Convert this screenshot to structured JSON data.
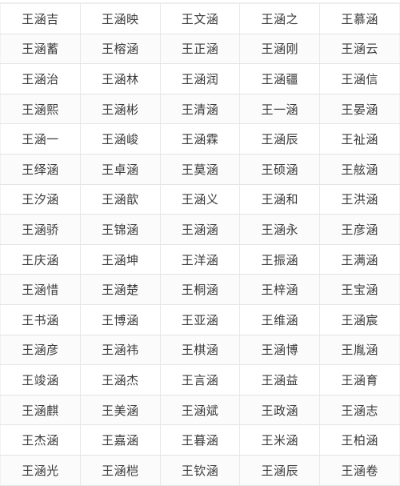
{
  "table": {
    "columns": 5,
    "rows": [
      [
        "王涵吉",
        "王涵映",
        "王文涵",
        "王涵之",
        "王慕涵"
      ],
      [
        "王涵蓄",
        "王榕涵",
        "王正涵",
        "王涵刚",
        "王涵云"
      ],
      [
        "王涵治",
        "王涵林",
        "王涵润",
        "王涵疆",
        "王涵信"
      ],
      [
        "王涵熙",
        "王涵彬",
        "王清涵",
        "王一涵",
        "王晏涵"
      ],
      [
        "王涵一",
        "王涵峻",
        "王涵霖",
        "王涵辰",
        "王祉涵"
      ],
      [
        "王绎涵",
        "王卓涵",
        "王莫涵",
        "王硕涵",
        "王舷涵"
      ],
      [
        "王汐涵",
        "王涵歆",
        "王涵义",
        "王涵和",
        "王洪涵"
      ],
      [
        "王涵骄",
        "王锦涵",
        "王涵涵",
        "王涵永",
        "王彦涵"
      ],
      [
        "王庆涵",
        "王涵坤",
        "王洋涵",
        "王振涵",
        "王满涵"
      ],
      [
        "王涵惜",
        "王涵楚",
        "王桐涵",
        "王梓涵",
        "王宝涵"
      ],
      [
        "王书涵",
        "王博涵",
        "王亚涵",
        "王维涵",
        "王涵宸"
      ],
      [
        "王涵彦",
        "王涵祎",
        "王棋涵",
        "王涵博",
        "王胤涵"
      ],
      [
        "王竣涵",
        "王涵杰",
        "王言涵",
        "王涵益",
        "王涵育"
      ],
      [
        "王涵麒",
        "王美涵",
        "王涵斌",
        "王政涵",
        "王涵志"
      ],
      [
        "王杰涵",
        "王嘉涵",
        "王暮涵",
        "王米涵",
        "王柏涵"
      ],
      [
        "王涵光",
        "王涵桤",
        "王钦涵",
        "王涵辰",
        "王涵卷"
      ]
    ]
  }
}
